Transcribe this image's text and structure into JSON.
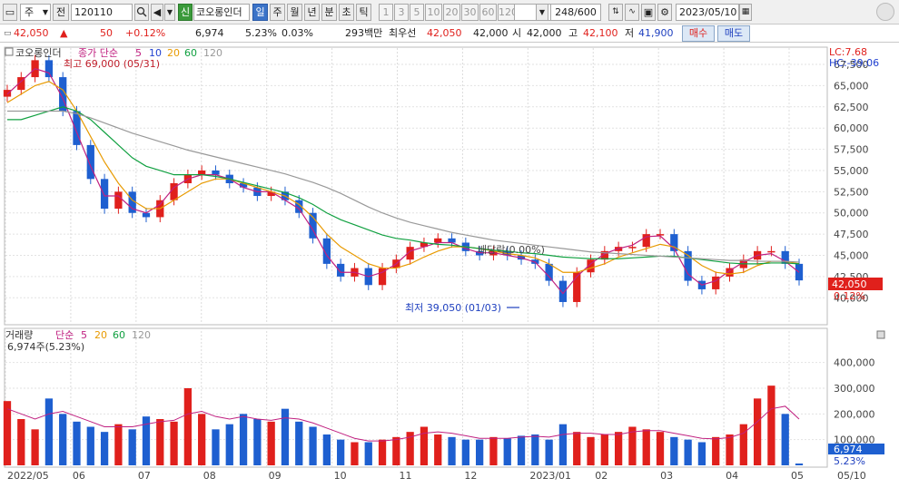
{
  "toolbar": {
    "period_sel": "주",
    "prev_btn": "전",
    "code": "120110",
    "new_badge": "신",
    "name": "코오롱인더",
    "periods": [
      "일",
      "주",
      "월",
      "년",
      "분",
      "초",
      "틱"
    ],
    "nums": [
      "1",
      "3",
      "5",
      "10",
      "20",
      "30",
      "60",
      "120"
    ],
    "count": "248/600",
    "date": "2023/05/10"
  },
  "info": {
    "price": "42,050",
    "arrow": "▲",
    "change": "50",
    "change_pct": "+0.12%",
    "volume": "6,974",
    "vol_ratio": "5.23%",
    "turnover": "0.03%",
    "amount": "293백만",
    "sell_label": "최우선",
    "sell_price": "42,050",
    "buy_price": "42,000",
    "open_label": "시",
    "open": "42,000",
    "high_label": "고",
    "high": "42,100",
    "low_label": "저",
    "low": "41,900",
    "buy_btn": "매수",
    "sell_btn": "매도"
  },
  "price_panel": {
    "legend_name": "코오롱인더",
    "legend_ma": "종가 단순",
    "ma_periods": [
      "5",
      "10",
      "20",
      "60",
      "120"
    ],
    "lc": "LC:7.68",
    "hc": "HC:-39.06",
    "max_note": "최고 69,000 (05/31)",
    "min_note": "최저 39,050 (01/03)",
    "div_note": "배당락(0.00%)",
    "cur_price_tag": "42,050",
    "cur_pct_tag": "0.12%"
  },
  "volume_panel": {
    "legend_name": "거래량",
    "legend_ma": "단순",
    "ma_periods": [
      "5",
      "20",
      "60",
      "120"
    ],
    "cur_vol": "6,974주(5.23%)",
    "cur_tag": "6,974",
    "cur_pct_tag": "5.23%"
  },
  "x_axis": [
    "2022/05",
    "06",
    "07",
    "08",
    "09",
    "10",
    "11",
    "12",
    "2023/01",
    "02",
    "03",
    "04",
    "05",
    "05/10"
  ],
  "chart_data": [
    {
      "type": "candlestick",
      "title": "코오롱인더",
      "ylim": [
        38000,
        69000
      ],
      "yticks": [
        "67,500",
        "65,000",
        "62,500",
        "60,000",
        "57,500",
        "55,000",
        "52,500",
        "50,000",
        "47,500",
        "45,000",
        "42,500",
        "40,000"
      ],
      "series": [
        {
          "name": "종가",
          "values": [
            64500,
            66000,
            68000,
            66000,
            62000,
            58000,
            54000,
            50500,
            52500,
            50000,
            49500,
            51500,
            53500,
            54500,
            55000,
            54500,
            53500,
            53000,
            52000,
            52500,
            51500,
            50000,
            47000,
            44000,
            42500,
            43500,
            41500,
            43500,
            44500,
            46000,
            46500,
            47000,
            46500,
            45500,
            45000,
            45500,
            45000,
            44500,
            44000,
            42000,
            39500,
            43000,
            44500,
            45500,
            46000,
            46000,
            47500,
            47500,
            45500,
            42000,
            41000,
            42500,
            43500,
            44500,
            45500,
            45500,
            44000,
            42050
          ]
        },
        {
          "name": "MA5",
          "values": [
            64000,
            65500,
            67000,
            66500,
            63500,
            59500,
            55500,
            52000,
            52000,
            50500,
            50000,
            51000,
            53000,
            54000,
            54500,
            54500,
            54000,
            53000,
            52500,
            52500,
            51500,
            50500,
            48000,
            45000,
            43000,
            43000,
            42500,
            43000,
            44000,
            45500,
            46000,
            46500,
            46500,
            45800,
            45300,
            45300,
            45000,
            44700,
            44200,
            42500,
            40500,
            42500,
            44000,
            45200,
            45800,
            46200,
            47200,
            47300,
            45800,
            42800,
            41500,
            42000,
            43200,
            44200,
            45000,
            45200,
            44300,
            43000
          ]
        },
        {
          "name": "MA20",
          "values": [
            63000,
            64000,
            65000,
            65500,
            64500,
            62000,
            59000,
            56000,
            53500,
            51500,
            50500,
            50500,
            51500,
            52500,
            53500,
            54000,
            54000,
            53500,
            53000,
            52500,
            52000,
            51000,
            49500,
            47500,
            46000,
            45000,
            44000,
            43500,
            43500,
            44000,
            44800,
            45500,
            46000,
            46000,
            45800,
            45500,
            45200,
            45000,
            44700,
            44000,
            43000,
            43000,
            43500,
            44000,
            44800,
            45300,
            45800,
            46300,
            46000,
            45000,
            43800,
            43000,
            42800,
            43000,
            43800,
            44300,
            44300,
            44000
          ]
        },
        {
          "name": "MA60",
          "values": [
            61000,
            61000,
            61500,
            62000,
            62500,
            62000,
            61000,
            59500,
            58000,
            56500,
            55500,
            55000,
            54500,
            54500,
            54500,
            54300,
            54000,
            53600,
            53200,
            52800,
            52400,
            51800,
            51000,
            50000,
            49200,
            48600,
            48000,
            47400,
            47000,
            46800,
            46500,
            46300,
            46200,
            46000,
            45800,
            45600,
            45500,
            45300,
            45200,
            45000,
            44800,
            44700,
            44600,
            44600,
            44600,
            44700,
            44800,
            44900,
            44900,
            44700,
            44500,
            44300,
            44100,
            44000,
            44000,
            44100,
            44100,
            44000
          ]
        },
        {
          "name": "MA120",
          "values": [
            62000,
            62000,
            62000,
            62000,
            62000,
            61700,
            61200,
            60600,
            60000,
            59400,
            58900,
            58400,
            57900,
            57400,
            57000,
            56600,
            56200,
            55800,
            55400,
            55000,
            54600,
            54100,
            53600,
            53000,
            52300,
            51500,
            50700,
            50000,
            49400,
            48900,
            48500,
            48100,
            47700,
            47400,
            47100,
            46800,
            46600,
            46400,
            46200,
            46000,
            45800,
            45600,
            45400,
            45300,
            45200,
            45100,
            45000,
            44900,
            44800,
            44700,
            44600,
            44500,
            44400,
            44400,
            44300,
            44300,
            44300,
            44200
          ]
        }
      ]
    },
    {
      "type": "bar",
      "title": "거래량",
      "ylim": [
        0,
        480000
      ],
      "yticks": [
        "400,000",
        "300,000",
        "200,000",
        "100,000"
      ],
      "series": [
        {
          "name": "거래량",
          "values": [
            250000,
            180000,
            140000,
            260000,
            200000,
            170000,
            150000,
            130000,
            160000,
            140000,
            190000,
            180000,
            170000,
            300000,
            200000,
            140000,
            160000,
            200000,
            180000,
            170000,
            220000,
            170000,
            150000,
            120000,
            100000,
            90000,
            90000,
            100000,
            110000,
            130000,
            150000,
            120000,
            110000,
            100000,
            100000,
            110000,
            105000,
            115000,
            120000,
            100000,
            160000,
            130000,
            110000,
            120000,
            130000,
            150000,
            140000,
            130000,
            110000,
            100000,
            90000,
            110000,
            120000,
            160000,
            260000,
            310000,
            200000,
            7000
          ]
        },
        {
          "name": "MA5",
          "values": [
            220000,
            200000,
            180000,
            200000,
            210000,
            190000,
            170000,
            150000,
            150000,
            150000,
            160000,
            170000,
            175000,
            200000,
            210000,
            190000,
            180000,
            190000,
            180000,
            175000,
            185000,
            180000,
            165000,
            145000,
            125000,
            105000,
            95000,
            95000,
            100000,
            110000,
            125000,
            130000,
            125000,
            115000,
            105000,
            105000,
            105000,
            110000,
            113000,
            110000,
            120000,
            125000,
            125000,
            120000,
            120000,
            130000,
            135000,
            135000,
            125000,
            115000,
            105000,
            103000,
            108000,
            125000,
            170000,
            220000,
            230000,
            180000
          ]
        }
      ]
    }
  ]
}
